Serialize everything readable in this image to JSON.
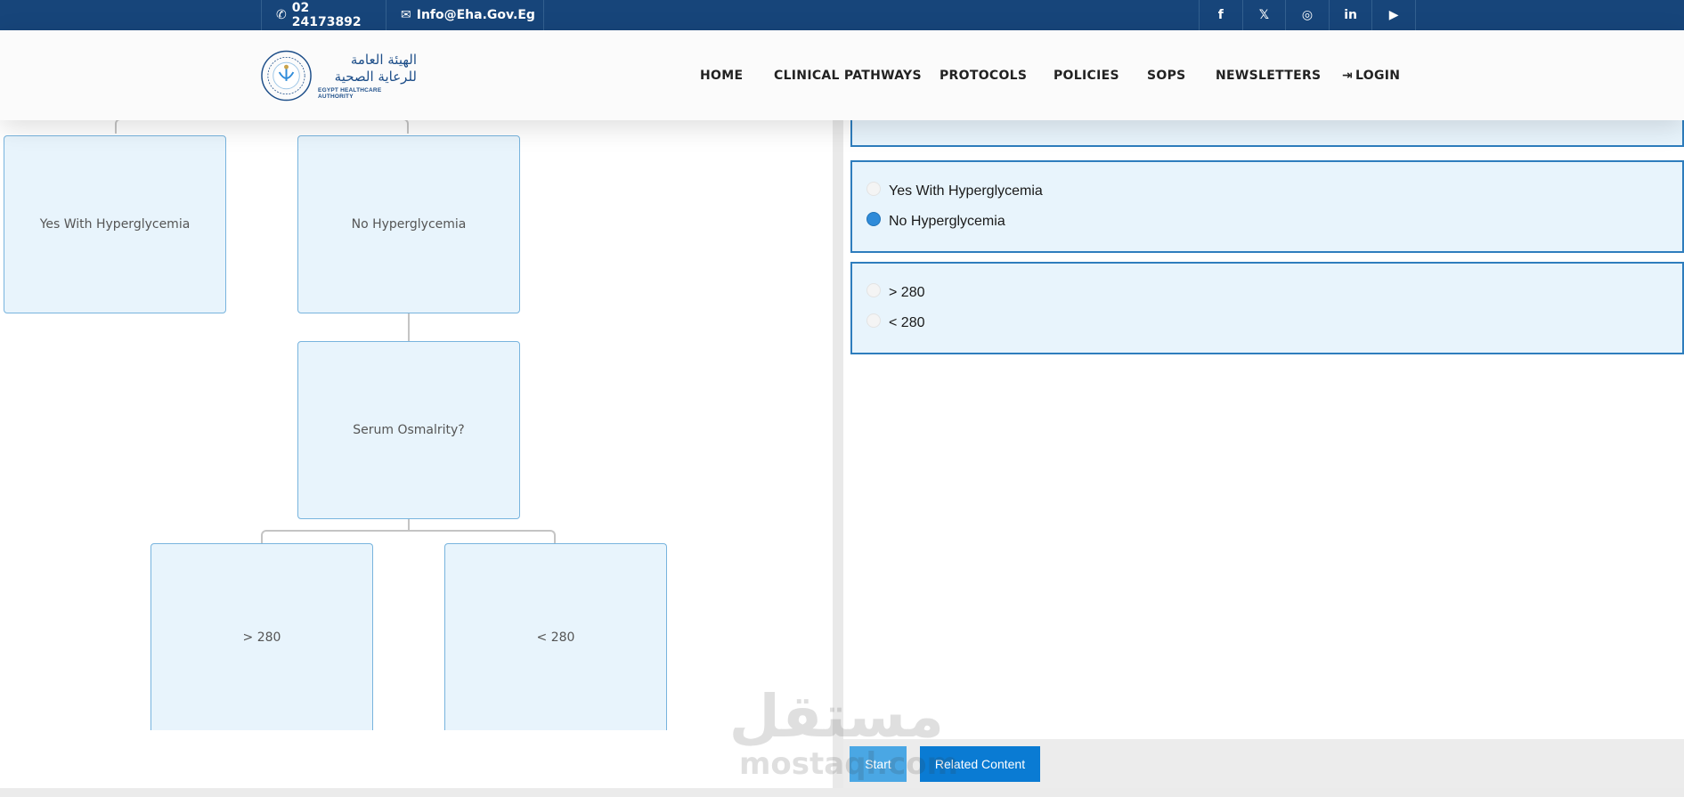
{
  "topbar": {
    "phone": "02 24173892",
    "email": "Info@Eha.Gov.Eg",
    "social": [
      {
        "icon": "facebook-icon",
        "glyph": "f"
      },
      {
        "icon": "x-icon",
        "glyph": "𝕏"
      },
      {
        "icon": "instagram-icon",
        "glyph": "◎"
      },
      {
        "icon": "linkedin-icon",
        "glyph": "in"
      },
      {
        "icon": "youtube-icon",
        "glyph": "▶"
      }
    ]
  },
  "logo": {
    "arabic_line1": "الهيئة العامة",
    "arabic_line2": "للرعاية الصحية",
    "english": "EGYPT HEALTHCARE AUTHORITY"
  },
  "nav": {
    "home": "HOME",
    "clinical_pathways": "CLINICAL PATHWAYS",
    "protocols": "PROTOCOLS",
    "policies": "POLICIES",
    "sops": "SOPS",
    "newsletters": "NEWSLETTERS",
    "login": "LOGIN"
  },
  "flowchart": {
    "node_yes_hyper": "Yes With Hyperglycemia",
    "node_no_hyper": "No Hyperglycemia",
    "node_serum": "Serum Osmalrity?",
    "node_gt280": "> 280",
    "node_lt280": "< 280"
  },
  "questions": [
    {
      "options": [
        {
          "label": "Yes With Hyperglycemia",
          "selected": false
        },
        {
          "label": "No Hyperglycemia",
          "selected": true
        }
      ]
    },
    {
      "options": [
        {
          "label": "> 280",
          "selected": false
        },
        {
          "label": "< 280",
          "selected": false
        }
      ]
    }
  ],
  "buttons": {
    "start": "Start",
    "related": "Related Content"
  },
  "watermark": {
    "arabic": "مستقل",
    "latin": "mostaql.com"
  },
  "colors": {
    "topbar": "#17457a",
    "node_fill": "#e8f4fc",
    "node_border": "#78b4de",
    "question_border": "#2e7dbd",
    "start_button": "#4aa7e4",
    "related_button": "#0a7bd3"
  }
}
